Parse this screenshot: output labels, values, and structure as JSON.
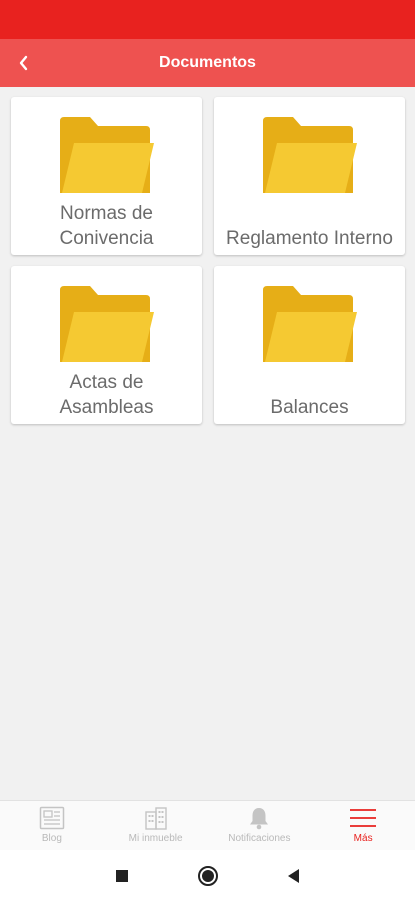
{
  "app_bar": {
    "title": "Documentos",
    "back_icon": "chevron-left-icon"
  },
  "folders": [
    {
      "label": "Normas de\nConivencia",
      "icon": "folder-icon"
    },
    {
      "label": "Reglamento Interno",
      "icon": "folder-icon"
    },
    {
      "label": "Actas de\nAsambleas",
      "icon": "folder-icon"
    },
    {
      "label": "Balances",
      "icon": "folder-icon"
    }
  ],
  "bottom_nav": {
    "items": [
      {
        "label": "Blog",
        "icon": "newspaper-icon",
        "active": false
      },
      {
        "label": "Mi inmueble",
        "icon": "building-icon",
        "active": false
      },
      {
        "label": "Notificaciones",
        "icon": "bell-icon",
        "active": false
      },
      {
        "label": "Más",
        "icon": "menu-icon",
        "active": true
      }
    ]
  },
  "system_nav": {
    "items": [
      "recents-square-icon",
      "home-circle-icon",
      "back-triangle-icon"
    ]
  },
  "colors": {
    "status_bar": "#e8221f",
    "app_bar": "#ee5250",
    "folder_back": "#e6ae17",
    "folder_front": "#f5c932",
    "active_nav": "#e8221f",
    "inactive_nav": "#b9b9b9"
  }
}
